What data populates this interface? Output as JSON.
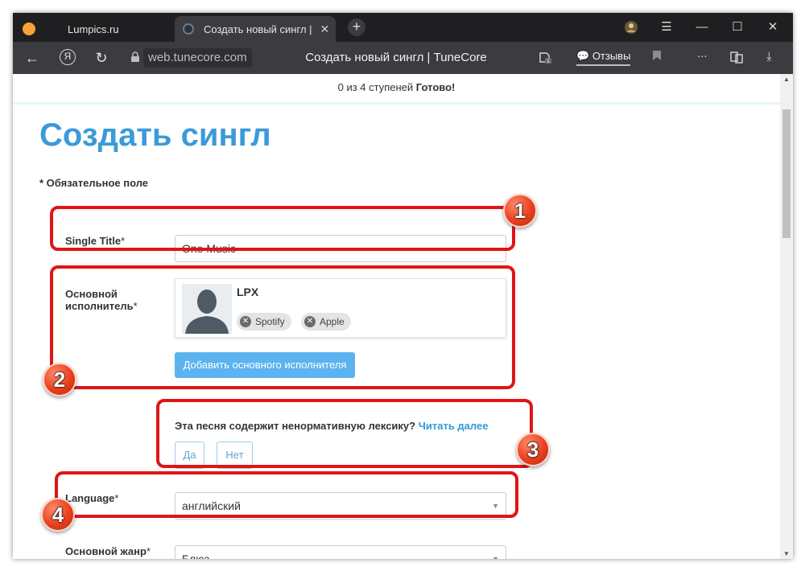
{
  "browser": {
    "tabs": [
      {
        "label": "Lumpics.ru"
      },
      {
        "label": "Создать новый сингл |"
      }
    ],
    "url": "web.tunecore.com",
    "page_title": "Создать новый сингл | TuneCore",
    "reviews_label": "Отзывы",
    "ya_label": "Я",
    "extension_count": "1",
    "menu_dots": "..."
  },
  "progress": {
    "text": "0 из 4 ступеней",
    "status": "Готово!"
  },
  "form": {
    "title": "Создать сингл",
    "required_note": "* Обязательное поле",
    "single_title_label": "Single Title",
    "single_title_value": "One Music",
    "main_artist_label_1": "Основной",
    "main_artist_label_2": "исполнитель",
    "artist_name": "LPX",
    "chips": [
      "Spotify",
      "Apple"
    ],
    "add_artist_button": "Добавить основного исполнителя",
    "explicit_question": "Эта песня содержит ненормативную лексику?",
    "read_more": "Читать далее",
    "yes": "Да",
    "no": "Нет",
    "language_label": "Language",
    "language_value": "английский",
    "genre_label": "Основной жанр",
    "genre_value": "Блюз",
    "star": "*"
  },
  "annotations": [
    "1",
    "2",
    "3",
    "4"
  ],
  "colors": {
    "accent": "#3b9ad9",
    "button": "#5bb3f0",
    "annotation": "#e01515"
  }
}
